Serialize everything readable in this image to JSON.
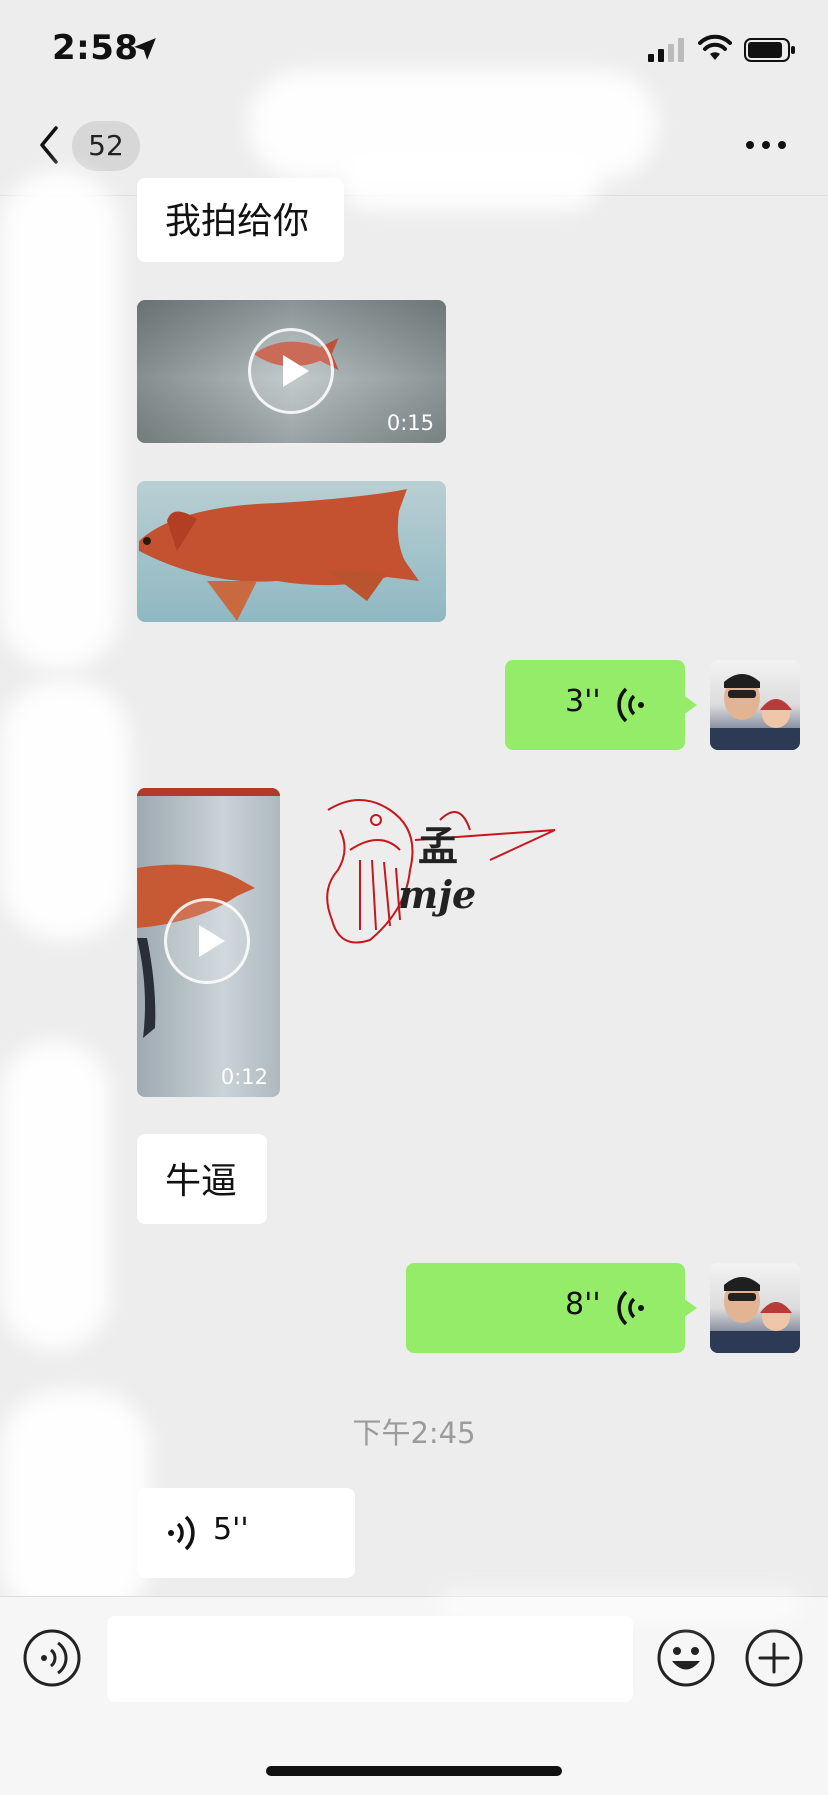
{
  "status_bar": {
    "time": "2:58",
    "location_icon": "location-arrow-icon",
    "signal_icon": "cellular-signal-icon",
    "wifi_icon": "wifi-icon",
    "battery_icon": "battery-icon"
  },
  "nav": {
    "back_icon": "chevron-left-icon",
    "unread_count": "52",
    "more_icon": "more-dots-icon"
  },
  "messages": [
    {
      "side": "in",
      "type": "text",
      "text": "我拍给你"
    },
    {
      "side": "in",
      "type": "video",
      "duration": "0:15"
    },
    {
      "side": "in",
      "type": "image"
    },
    {
      "side": "out",
      "type": "voice",
      "duration": "3''"
    },
    {
      "side": "in",
      "type": "video",
      "duration": "0:12"
    },
    {
      "side": "in",
      "type": "sticker",
      "text": "mje"
    },
    {
      "side": "in",
      "type": "text",
      "text": "牛逼"
    },
    {
      "side": "out",
      "type": "voice",
      "duration": "8''"
    },
    {
      "type": "timestamp",
      "text": "下午2:45"
    },
    {
      "side": "in",
      "type": "voice",
      "duration": "5''"
    }
  ],
  "input_bar": {
    "voice_icon": "voice-input-icon",
    "input_value": "",
    "emoji_icon": "emoji-icon",
    "plus_icon": "plus-icon"
  },
  "colors": {
    "background": "#ededed",
    "outgoing_bubble": "#95ec69",
    "incoming_bubble": "#ffffff"
  }
}
